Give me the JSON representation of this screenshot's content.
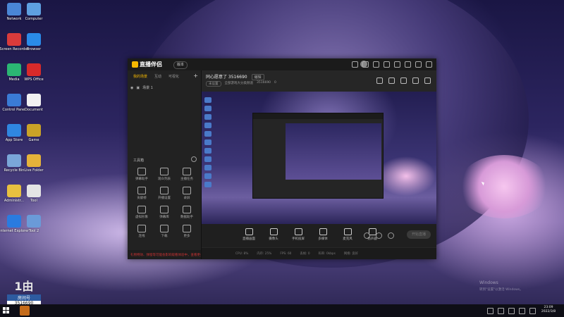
{
  "desktop": {
    "icons": [
      {
        "label": "Network",
        "color": "#4a86d6"
      },
      {
        "label": "Computer",
        "color": "#5ea0e0"
      },
      {
        "label": "Screen Recorder",
        "color": "#d93b3b"
      },
      {
        "label": "Browser",
        "color": "#2a8be8"
      },
      {
        "label": "Media",
        "color": "#2bb673"
      },
      {
        "label": "WPS Office",
        "color": "#d82a2a"
      },
      {
        "label": "Control Panel",
        "color": "#3a7bd5"
      },
      {
        "label": "Document",
        "color": "#f2f2f2"
      },
      {
        "label": "App Store",
        "color": "#2f86e0"
      },
      {
        "label": "Game",
        "color": "#c9a227"
      },
      {
        "label": "Recycle Bin",
        "color": "#7aa6d8"
      },
      {
        "label": "Live Folder",
        "color": "#e5b33a"
      },
      {
        "label": "Administr...",
        "color": "#e8c040"
      },
      {
        "label": "Tool",
        "color": "#e4e4e4"
      },
      {
        "label": "Internet Explorer",
        "color": "#2a7be0"
      },
      {
        "label": "Tool 2",
        "color": "#6a9ad8"
      }
    ],
    "room_badge": {
      "big": "1由",
      "label": "房间号",
      "number": "3516690"
    },
    "watermark": "Windows",
    "watermark_sub": "转到\"设置\"以激活 Windows。"
  },
  "app": {
    "title": "直播伴侣",
    "version_button": "版本",
    "left_panel": {
      "tabs": [
        "我的场景",
        "互动",
        "可视化"
      ],
      "scene": "场景 1",
      "tools_title": "工具箱",
      "tools": [
        "弹幕助手",
        "观众列表",
        "主播任务",
        "贡献榜",
        "开播设置",
        "录屏",
        "虚拟形象",
        "弹幕库",
        "数据助手",
        "连线",
        "下载",
        "更多"
      ],
      "footer": "礼物特效、弹窗等可能会影响观看体验中，查看更多"
    },
    "main": {
      "room_title": "同心愿意了 3516690",
      "edit_label": "编辑",
      "sub_pill": "未设置",
      "sub_category": "全部游戏大分类频道",
      "sub_id": "3516690",
      "sub_count": "0"
    },
    "bottom_bar": {
      "items": [
        "直播画面",
        "摄像头",
        "手机投屏",
        "多媒体",
        "麦克风",
        "扬声器"
      ],
      "start_button": "开始直播"
    },
    "status_bar": [
      "CPU: 8%",
      "内存: 25%",
      "FPS: 60",
      "丢帧: 0",
      "码率: 0kbps",
      "网络: 良好"
    ]
  },
  "taskbar": {
    "time": "23:09",
    "date": "2022/3/8"
  }
}
